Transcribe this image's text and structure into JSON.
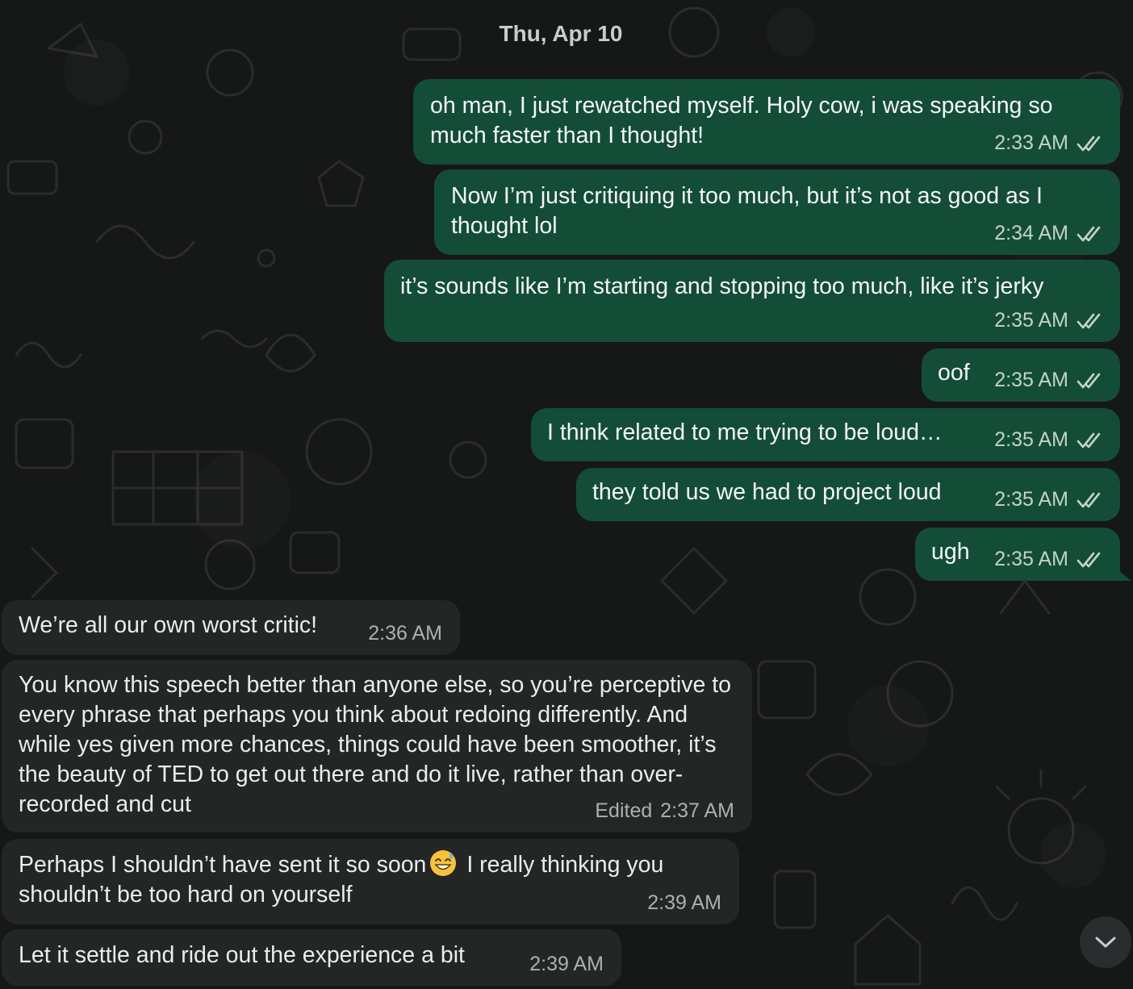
{
  "date_separator": "Thu, Apr 10",
  "messages": [
    {
      "direction": "outgoing",
      "text": "oh man, I just rewatched myself. Holy cow, i was speaking so much faster than I thought!",
      "time": "2:33 AM",
      "status": "read"
    },
    {
      "direction": "outgoing",
      "text": "Now I’m just critiquing it too much, but it’s not as good as I thought lol",
      "time": "2:34 AM",
      "status": "read"
    },
    {
      "direction": "outgoing",
      "text": "it’s sounds like I’m starting and stopping too much, like it’s jerky",
      "time": "2:35 AM",
      "status": "read"
    },
    {
      "direction": "outgoing",
      "text": "oof",
      "time": "2:35 AM",
      "status": "read"
    },
    {
      "direction": "outgoing",
      "text": "I think related to me trying to be loud…",
      "time": "2:35 AM",
      "status": "read"
    },
    {
      "direction": "outgoing",
      "text": "they told us we had to project loud",
      "time": "2:35 AM",
      "status": "read"
    },
    {
      "direction": "outgoing",
      "text": "ugh",
      "time": "2:35 AM",
      "status": "read"
    },
    {
      "direction": "incoming",
      "text": "We’re all our own worst critic!",
      "time": "2:36 AM"
    },
    {
      "direction": "incoming",
      "text": "You know this speech better than anyone else, so you’re perceptive to every phrase that perhaps you think about redoing differently. And while yes given more chances, things could have been smoother, it’s the beauty of TED to get out there and do it live, rather than over-recorded and cut",
      "time": "2:37 AM",
      "edited_label": "Edited"
    },
    {
      "direction": "incoming",
      "text_before_emoji": "Perhaps I shouldn’t have sent it so soon",
      "emoji": "grinning-face-with-sweat",
      "text_after_emoji": "I really thinking you shouldn’t be too hard on yourself",
      "time": "2:39 AM"
    },
    {
      "direction": "incoming",
      "text": "Let it settle and ride out the experience a bit",
      "time": "2:39 AM"
    }
  ],
  "colors": {
    "background": "#161717",
    "outgoing_bubble": "#144d37",
    "incoming_bubble": "#242626"
  },
  "scroll_button": {
    "icon": "chevron-down-icon"
  }
}
